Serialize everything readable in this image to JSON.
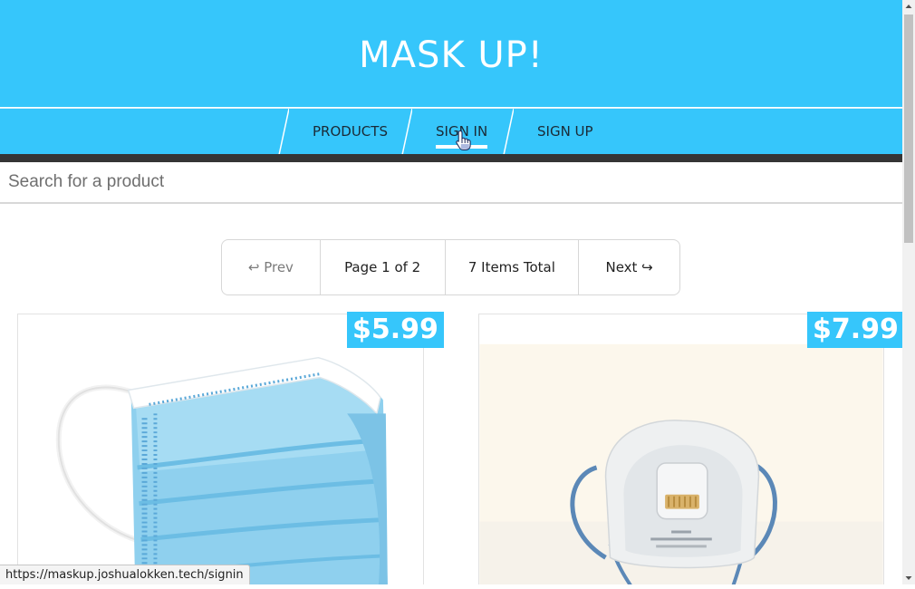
{
  "header": {
    "title": "MASK UP!"
  },
  "nav": {
    "items": [
      {
        "label": "PRODUCTS"
      },
      {
        "label": "SIGN IN",
        "active": true
      },
      {
        "label": "SIGN UP"
      }
    ]
  },
  "search": {
    "placeholder": "Search for a product",
    "value": ""
  },
  "pagination": {
    "prev_label": "↩ Prev",
    "page_label": "Page 1 of 2",
    "total_label": "7 Items Total",
    "next_label": "Next ↪"
  },
  "products": [
    {
      "price": "$5.99",
      "image_icon": "surgical-mask-image"
    },
    {
      "price": "$7.99",
      "image_icon": "respirator-mask-image"
    }
  ],
  "status_bar": {
    "url": "https://maskup.joshualokken.tech/signin"
  },
  "colors": {
    "brand": "#36c6fb",
    "dark_bar": "#353535",
    "text": "#1b2a36"
  }
}
